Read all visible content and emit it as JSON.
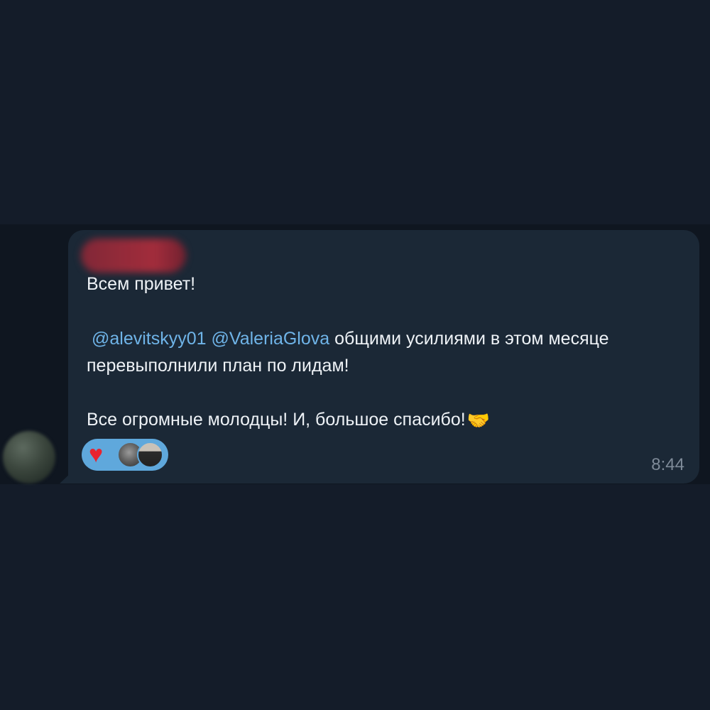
{
  "message": {
    "greeting": "Всем привет!",
    "mention_1": "@alevitskyy01",
    "mention_2": "@ValeriaGlova",
    "line2_rest": "общими усилиями в этом месяце",
    "line3": "перевыполнили план по лидам!",
    "line4": "Все огромные молодцы! И, большое спасибо!",
    "emoji": "🤝",
    "time": "8:44"
  },
  "reactions": {
    "emoji": "♥",
    "reactor_count": 2
  },
  "colors": {
    "page_background": "#141c29",
    "chat_background": "#0f1620",
    "bubble": "#1b2836",
    "mention": "#6fb4e8",
    "reaction_pill": "#5fa8dc",
    "heart": "#e8232f"
  }
}
